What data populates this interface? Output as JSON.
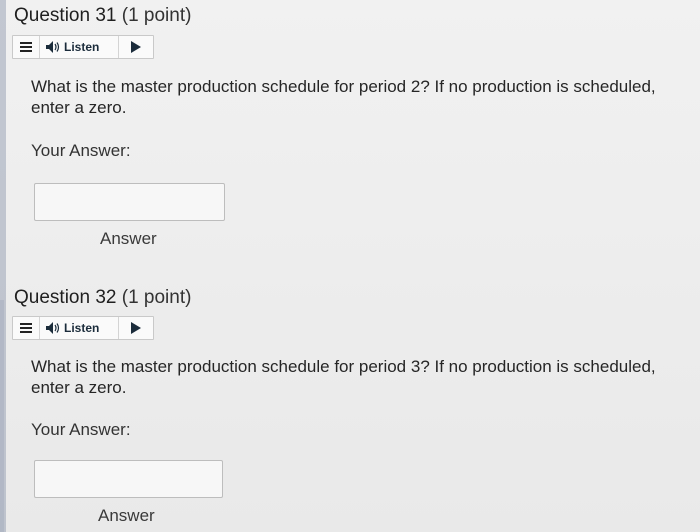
{
  "questions": [
    {
      "number": "Question 31",
      "points": "(1 point)",
      "listen_label": "Listen",
      "text": "What is the master production schedule for period 2? If no production is scheduled, enter a zero.",
      "answer_label": "Your Answer:",
      "input_value": "",
      "answer_button": "Answer"
    },
    {
      "number": "Question 32",
      "points": "(1 point)",
      "listen_label": "Listen",
      "text": "What is the master production schedule for period 3? If no production is scheduled, enter a zero.",
      "answer_label": "Your Answer:",
      "input_value": "",
      "answer_button": "Answer"
    }
  ],
  "icons": {
    "menu": "menu-icon",
    "speaker": "speaker-icon",
    "play": "play-icon"
  }
}
